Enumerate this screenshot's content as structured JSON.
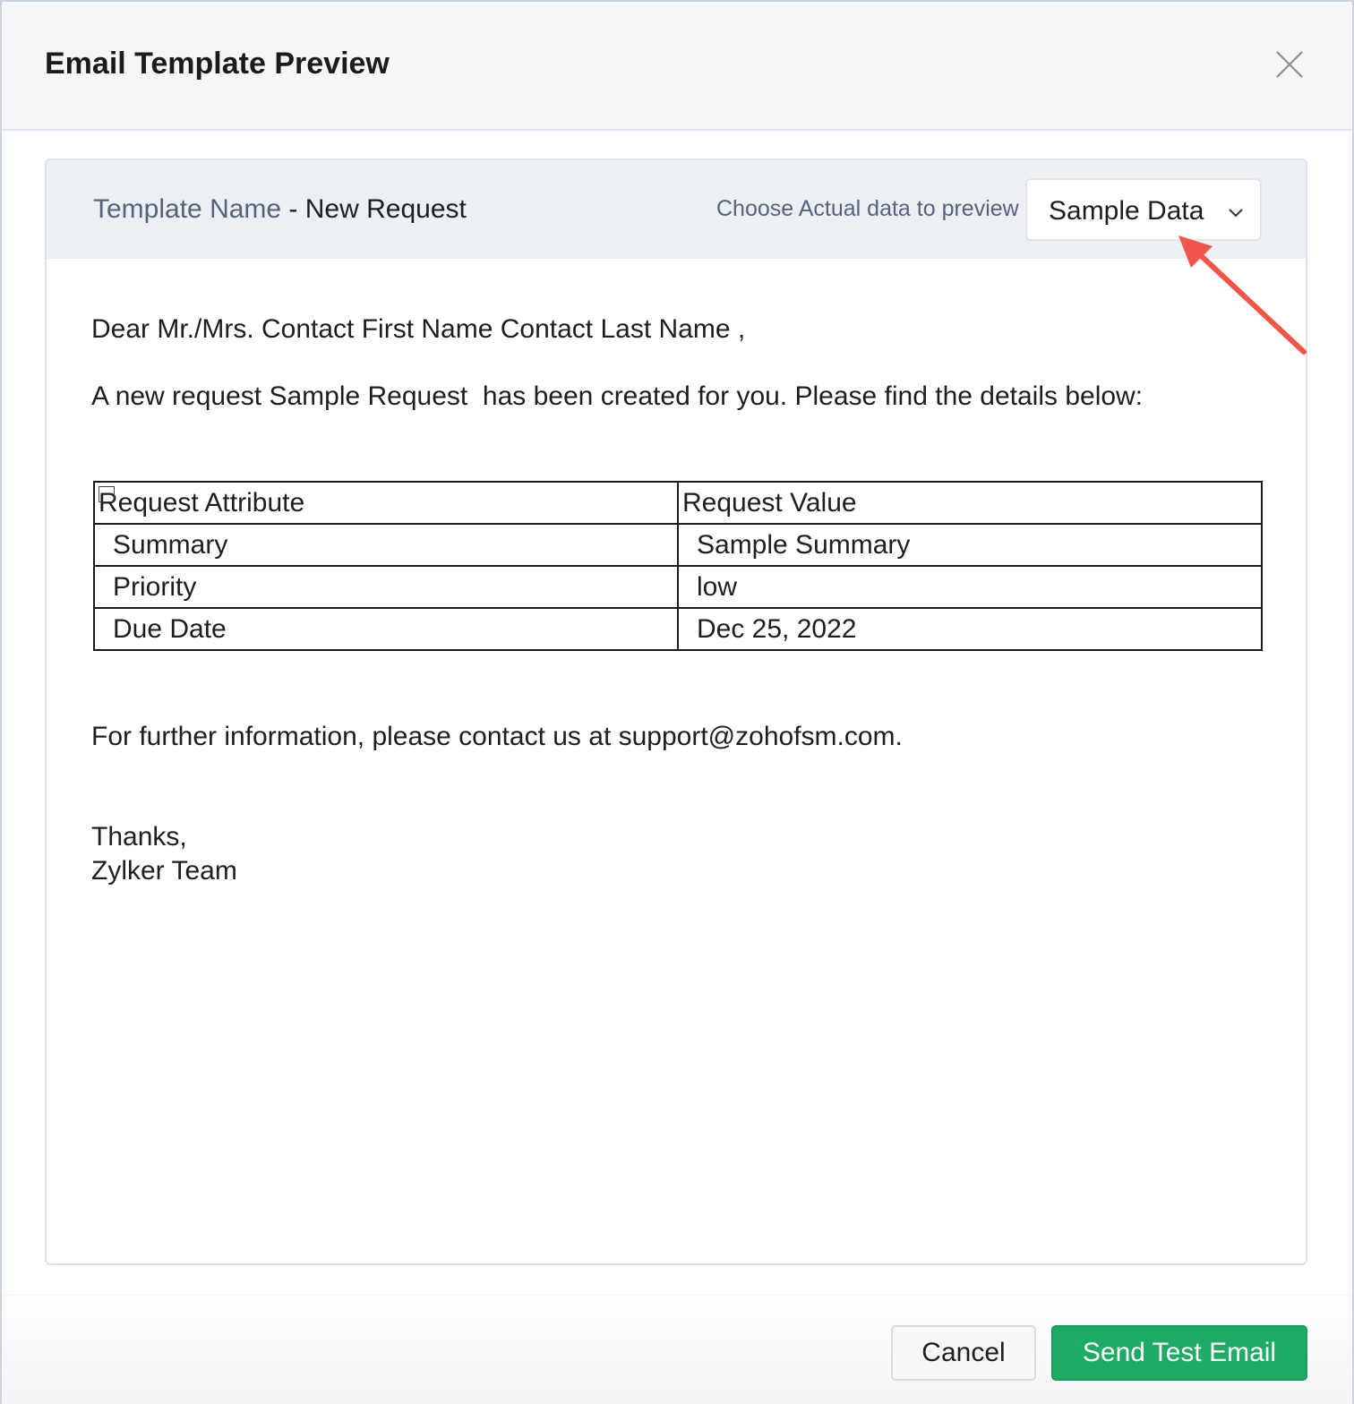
{
  "dialog": {
    "title": "Email Template Preview",
    "close_icon": "close-icon"
  },
  "preview_header": {
    "template_label": "Template Name",
    "separator": " - ",
    "template_value": "New Request",
    "choose_label": "Choose Actual data to preview",
    "data_select": {
      "selected": "Sample Data",
      "icon": "chevron-down-icon"
    }
  },
  "email": {
    "greeting": "Dear Mr./Mrs. Contact First Name Contact Last Name ,",
    "intro": "A new request Sample Request  has been created for you. Please find the details below:",
    "table": {
      "headers": [
        "Request Attribute",
        "Request Value"
      ],
      "rows": [
        [
          "Summary",
          "Sample Summary"
        ],
        [
          "Priority",
          "low"
        ],
        [
          "Due Date",
          "Dec 25, 2022"
        ]
      ]
    },
    "contact_line": "For further information, please contact us at support@zohofsm.com.",
    "closing": "Thanks,",
    "signature": "Zylker Team"
  },
  "footer": {
    "cancel_label": "Cancel",
    "send_label": "Send Test Email"
  },
  "colors": {
    "primary_green": "#1faa65",
    "header_bg": "#f4f6f8",
    "label_gray": "#56627a",
    "annotation_red": "#f0564a"
  }
}
